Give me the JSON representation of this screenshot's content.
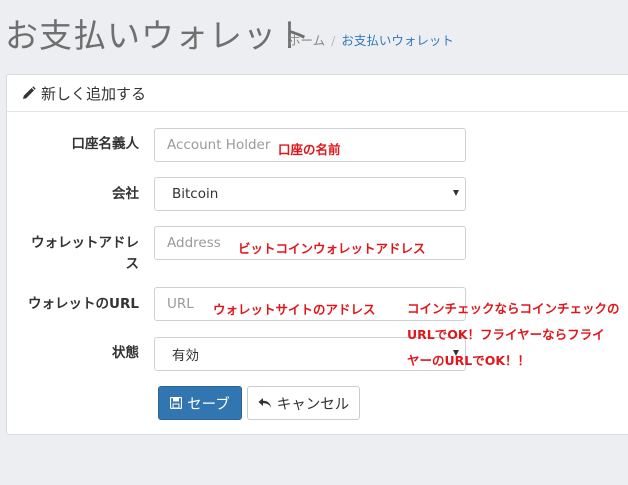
{
  "header": {
    "title": "お支払いウォレット",
    "breadcrumb": {
      "home": "ホーム",
      "separator": "/",
      "current": "お支払いウォレット"
    }
  },
  "panel": {
    "heading": "新しく追加する"
  },
  "form": {
    "account_holder": {
      "label": "口座名義人",
      "value": "",
      "placeholder": "Account Holder"
    },
    "company": {
      "label": "会社",
      "value": "Bitcoin"
    },
    "wallet_address": {
      "label_line1": "ウォレットアドレ",
      "label_line2": "ス",
      "value": "",
      "placeholder": "Address"
    },
    "wallet_url": {
      "label": "ウォレットのURL",
      "value": "",
      "placeholder": "URL"
    },
    "status": {
      "label": "状態",
      "value": "有効"
    }
  },
  "annotations": {
    "account_holder_note": "口座の名前",
    "address_note": "ビットコインウォレットアドレス",
    "url_note": "ウォレットサイトのアドレス",
    "url_example_line1": "コインチェックならコインチェックの",
    "url_example_line2": "URLでOK！フライヤーならフライ",
    "url_example_line3": "ヤーのURLでOK！！"
  },
  "buttons": {
    "save": "セーブ",
    "cancel": "キャンセル"
  },
  "colors": {
    "primary": "#3276b1",
    "annotation": "#e0161b",
    "link": "#337ab7",
    "background": "#eceef2"
  }
}
